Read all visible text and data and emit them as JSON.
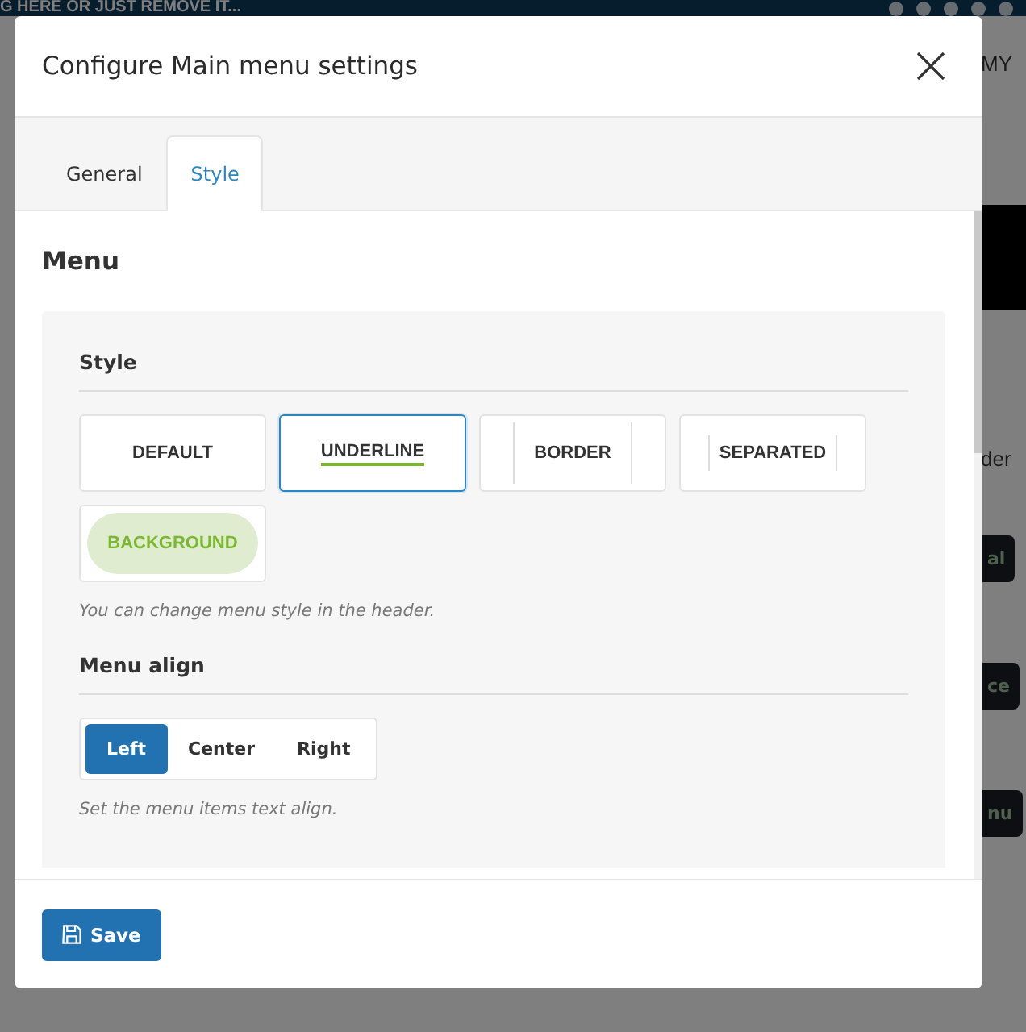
{
  "background": {
    "banner_text": "G HERE OR JUST REMOVE IT...",
    "side_texts": [
      {
        "text": "MY",
        "kind": "label"
      },
      {
        "text": "der",
        "kind": "label"
      },
      {
        "text": "al",
        "kind": "button"
      },
      {
        "text": "ce",
        "kind": "button"
      },
      {
        "text": "nu",
        "kind": "button"
      }
    ]
  },
  "dialog": {
    "title": "Configure Main menu settings",
    "tabs": [
      {
        "label": "General",
        "selected": false
      },
      {
        "label": "Style",
        "selected": true
      }
    ],
    "section_title": "Menu",
    "style_group": {
      "label": "Style",
      "hint": "You can change menu style in the header.",
      "options": [
        {
          "label": "DEFAULT",
          "kind": "default",
          "selected": false
        },
        {
          "label": "UNDERLINE",
          "kind": "underline",
          "selected": true
        },
        {
          "label": "BORDER",
          "kind": "border",
          "selected": false
        },
        {
          "label": "SEPARATED",
          "kind": "separated",
          "selected": false
        },
        {
          "label": "BACKGROUND",
          "kind": "background",
          "selected": false
        }
      ]
    },
    "align_group": {
      "label": "Menu align",
      "hint": "Set the menu items text align.",
      "options": [
        {
          "label": "Left",
          "selected": true
        },
        {
          "label": "Center",
          "selected": false
        },
        {
          "label": "Right",
          "selected": false
        }
      ]
    },
    "save_button": "Save"
  }
}
